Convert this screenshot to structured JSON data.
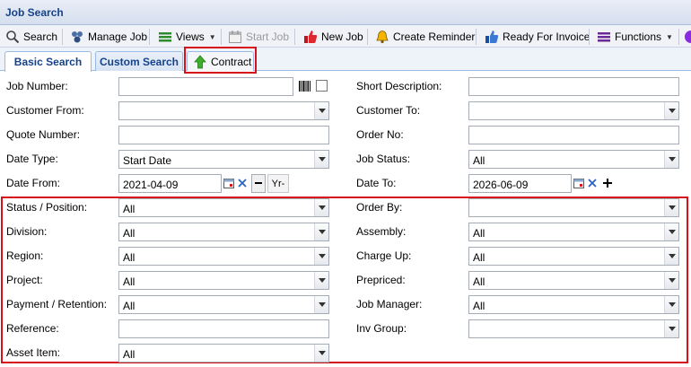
{
  "window": {
    "title": "Job Search"
  },
  "toolbar": {
    "search": "Search",
    "manage_job": "Manage Job",
    "views": "Views",
    "start_job": "Start Job",
    "new_job": "New Job",
    "create_reminder": "Create Reminder",
    "ready_for_invoice": "Ready For Invoice",
    "functions": "Functions"
  },
  "tabs": {
    "basic": "Basic Search",
    "custom": "Custom Search",
    "contract": "Contract"
  },
  "labels": {
    "job_number": "Job Number:",
    "short_description": "Short Description:",
    "customer_from": "Customer From:",
    "customer_to": "Customer To:",
    "quote_number": "Quote Number:",
    "order_no": "Order No:",
    "date_type": "Date Type:",
    "job_status": "Job Status:",
    "date_from": "Date From:",
    "date_to": "Date To:",
    "status_position": "Status / Position:",
    "order_by": "Order By:",
    "division": "Division:",
    "assembly": "Assembly:",
    "region": "Region:",
    "charge_up": "Charge Up:",
    "project": "Project:",
    "prepriced": "Prepriced:",
    "payment_retention": "Payment / Retention:",
    "job_manager": "Job Manager:",
    "reference": "Reference:",
    "inv_group": "Inv Group:",
    "asset_item": "Asset Item:"
  },
  "values": {
    "date_type": "Start Date",
    "job_status": "All",
    "date_from": "2021-04-09",
    "date_to": "2026-06-09",
    "year_button": "Yr-",
    "status_position": "All",
    "division": "All",
    "assembly": "All",
    "region": "All",
    "charge_up": "All",
    "project": "All",
    "prepriced": "All",
    "payment_retention": "All",
    "job_manager": "All",
    "asset_item": "All"
  },
  "colors": {
    "highlight_box": "#d8101a",
    "title_text": "#15428b"
  }
}
